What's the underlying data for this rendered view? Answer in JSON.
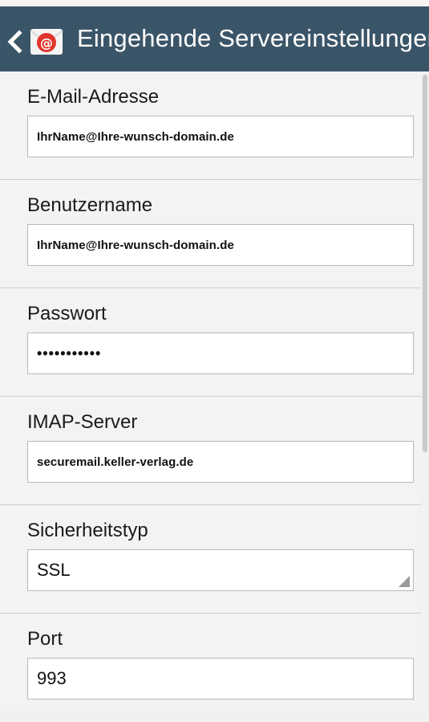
{
  "header": {
    "title": "Eingehende Servereinstellungen",
    "back_icon": "chevron-left-icon",
    "app_icon": "email-at-icon",
    "color": "#3b5568"
  },
  "fields": {
    "email": {
      "label": "E-Mail-Adresse",
      "value": "IhrName@Ihre-wunsch-domain.de"
    },
    "username": {
      "label": "Benutzername",
      "value": "IhrName@Ihre-wunsch-domain.de"
    },
    "password": {
      "label": "Passwort",
      "value": "•••••••••••"
    },
    "imap_server": {
      "label": "IMAP-Server",
      "value": "securemail.keller-verlag.de"
    },
    "security_type": {
      "label": "Sicherheitstyp",
      "value": "SSL"
    },
    "port": {
      "label": "Port",
      "value": "993"
    }
  }
}
